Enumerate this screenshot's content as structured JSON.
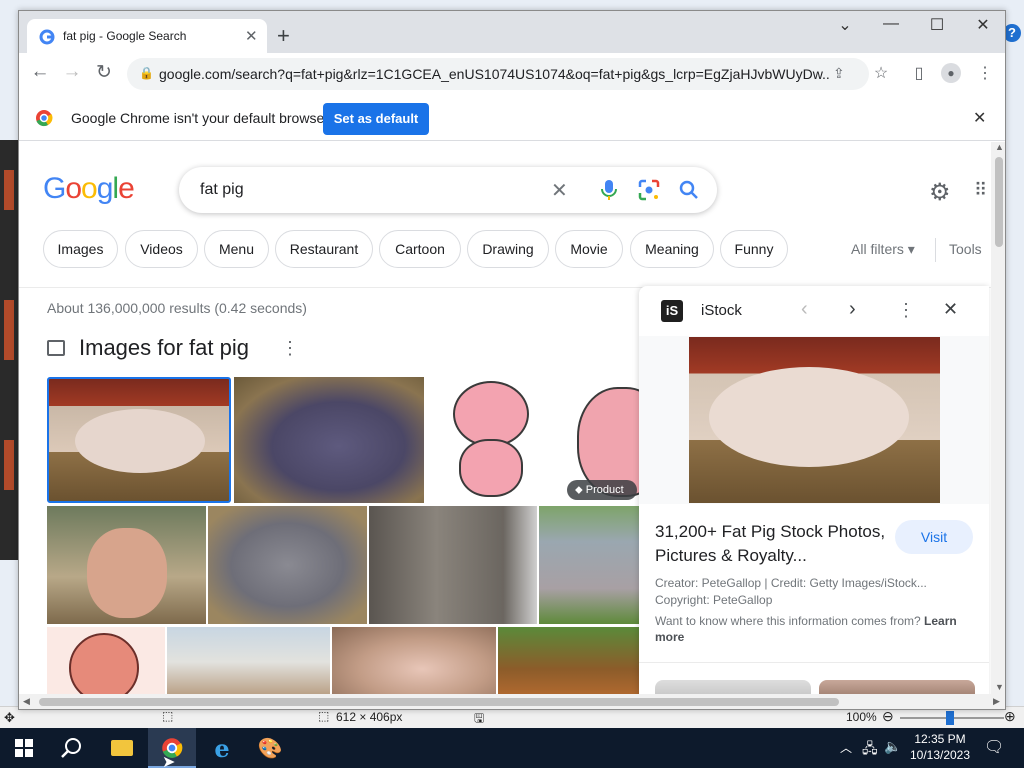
{
  "browser": {
    "tab_title": "fat pig - Google Search",
    "url": "google.com/search?q=fat+pig&rlz=1C1GCEA_enUS1074US1074&oq=fat+pig&gs_lcrp=EgZjaHJvbWUyDw...",
    "infobar_message": "Google Chrome isn't your default browser",
    "set_default_label": "Set as default"
  },
  "search": {
    "logo": "Google",
    "query": "fat pig",
    "chips": [
      "Images",
      "Videos",
      "Menu",
      "Restaurant",
      "Cartoon",
      "Drawing",
      "Movie",
      "Meaning",
      "Funny"
    ],
    "all_filters": "All filters",
    "tools": "Tools",
    "stats": "About 136,000,000 results (0.42 seconds)",
    "images_heading": "Images for fat pig",
    "product_badge": "Product"
  },
  "panel": {
    "source": "iStock",
    "title": "31,200+ Fat Pig Stock Photos, Pictures & Royalty...",
    "visit": "Visit",
    "creator": "Creator: PeteGallop | Credit: Getty Images/iStock...",
    "copyright": "Copyright: PeteGallop",
    "info_question": "Want to know where this information comes from?",
    "learn_more": "Learn more"
  },
  "paint_status": {
    "size": "612 × 406px",
    "zoom": "100%"
  },
  "taskbar": {
    "time": "12:35 PM",
    "date": "10/13/2023"
  },
  "colors": {
    "google_blue": "#4285f4",
    "google_red": "#ea4335",
    "google_yellow": "#fbbc05",
    "google_green": "#34a853",
    "chrome_button": "#1a73e8"
  }
}
